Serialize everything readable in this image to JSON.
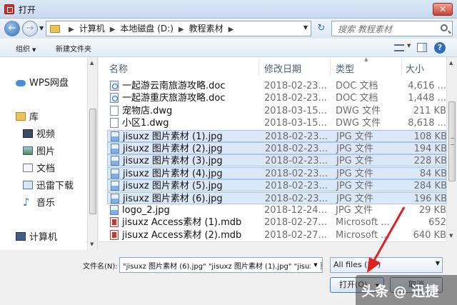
{
  "window": {
    "title": "打开",
    "close_glyph": "✕"
  },
  "nav": {
    "back_glyph": "←",
    "forward_glyph": "→",
    "breadcrumb": [
      "计算机",
      "本地磁盘 (D:)",
      "教程素材"
    ],
    "search_placeholder": "搜索 教程素材",
    "refresh_glyph": "↻"
  },
  "toolbar": {
    "organize": "组织",
    "new_folder": "新建文件夹",
    "help_glyph": "?"
  },
  "sidebar": {
    "items": [
      {
        "label": "WPS网盘",
        "icon": "cloud-icon"
      },
      {
        "label": "库",
        "icon": "library-icon"
      },
      {
        "label": "视频",
        "icon": "video-icon"
      },
      {
        "label": "图片",
        "icon": "pictures-icon"
      },
      {
        "label": "文档",
        "icon": "documents-icon"
      },
      {
        "label": "迅雷下载",
        "icon": "download-icon"
      },
      {
        "label": "音乐",
        "icon": "music-icon"
      },
      {
        "label": "计算机",
        "icon": "computer-icon"
      }
    ]
  },
  "columns": {
    "name": "名称",
    "date": "修改日期",
    "type": "类型",
    "size": "大小"
  },
  "files": [
    {
      "name": "一起游云南旅游攻略.doc",
      "date": "2018-02-23...",
      "type": "DOC 文档",
      "size": "4,616 ...",
      "icon": "doc",
      "selected": false
    },
    {
      "name": "一起游重庆旅游攻略.doc",
      "date": "2018-02-23...",
      "type": "DOC 文档",
      "size": "1,448 ...",
      "icon": "doc",
      "selected": false
    },
    {
      "name": "宠物店.dwg",
      "date": "2018-03-15...",
      "type": "DWG 文件",
      "size": "211 KB",
      "icon": "dwg",
      "selected": false
    },
    {
      "name": "小区1.dwg",
      "date": "2018-03-15...",
      "type": "DWG 文件",
      "size": "8,618 ...",
      "icon": "dwg",
      "selected": false
    },
    {
      "name": "jisuxz 图片素材 (1).jpg",
      "date": "2018-02-23...",
      "type": "JPG 文件",
      "size": "108 KB",
      "icon": "jpg",
      "selected": true
    },
    {
      "name": "jisuxz 图片素材 (2).jpg",
      "date": "2018-02-23...",
      "type": "JPG 文件",
      "size": "194 KB",
      "icon": "jpg",
      "selected": true
    },
    {
      "name": "jisuxz 图片素材 (3).jpg",
      "date": "2018-02-23...",
      "type": "JPG 文件",
      "size": "228 KB",
      "icon": "jpg",
      "selected": true
    },
    {
      "name": "jisuxz 图片素材 (4).jpg",
      "date": "2018-02-23...",
      "type": "JPG 文件",
      "size": "84 KB",
      "icon": "jpg",
      "selected": true
    },
    {
      "name": "jisuxz 图片素材 (5).jpg",
      "date": "2018-02-23...",
      "type": "JPG 文件",
      "size": "284 KB",
      "icon": "jpg",
      "selected": true
    },
    {
      "name": "jisuxz 图片素材 (6).jpg",
      "date": "2018-02-23...",
      "type": "JPG 文件",
      "size": "196 KB",
      "icon": "jpg",
      "selected": true
    },
    {
      "name": "logo_2.jpg",
      "date": "2018-12-24...",
      "type": "JPG 文件",
      "size": "29 KB",
      "icon": "jpg",
      "selected": false
    },
    {
      "name": "jisuxz Access素材 (1).mdb",
      "date": "2018-02-27...",
      "type": "Microsoft ...",
      "size": "652",
      "icon": "mdb",
      "selected": false
    },
    {
      "name": "jisuxz Access素材 (2).mdb",
      "date": "2018-02-27...",
      "type": "Microsoft ...",
      "size": "640 KB",
      "icon": "mdb",
      "selected": false
    }
  ],
  "footer": {
    "filename_label": "文件名(N):",
    "filename_value": "\"jisuxz 图片素材 (6).jpg\" \"jisuxz 图片素材 (1).jpg\" \"jisuxz 图",
    "filter_value": "All files (*.*)",
    "open_label": "打开(O)",
    "cancel_label": "取消"
  },
  "watermark": "头条 @ 迅捷",
  "colors": {
    "selection": "#dbe8f7",
    "selection_border": "#a9c6ea",
    "accent": "#2d6fb8",
    "arrow": "#e02020"
  }
}
